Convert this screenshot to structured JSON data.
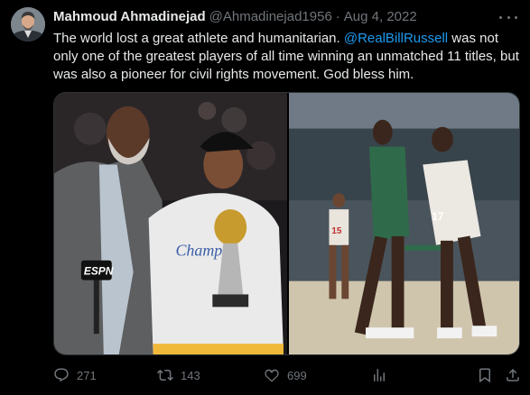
{
  "author": {
    "name": "Mahmoud Ahmadinejad",
    "handle": "@Ahmadinejad1956",
    "separator": "·",
    "date": "Aug 4, 2022"
  },
  "tweet": {
    "text_before": "The world lost a great athlete and humanitarian. ",
    "mention": "@RealBillRussell",
    "text_after": " was not only one of the greatest players of all time winning an unmatched 11 titles, but was also a pioneer for civil rights movement. God bless him."
  },
  "media": {
    "left_photo": {
      "icon": "photo-champions-trophy",
      "mic_flag_text": "ESPN",
      "shirt_text": "Champ"
    },
    "right_photo": {
      "icon": "photo-basketball-game",
      "jersey_numbers": [
        "15",
        "17"
      ]
    }
  },
  "actions": {
    "reply_count": "271",
    "repost_count": "143",
    "like_count": "699"
  },
  "colors": {
    "background": "#000000",
    "text": "#e7e9ea",
    "muted": "#71767b",
    "link": "#1d9bf0"
  }
}
